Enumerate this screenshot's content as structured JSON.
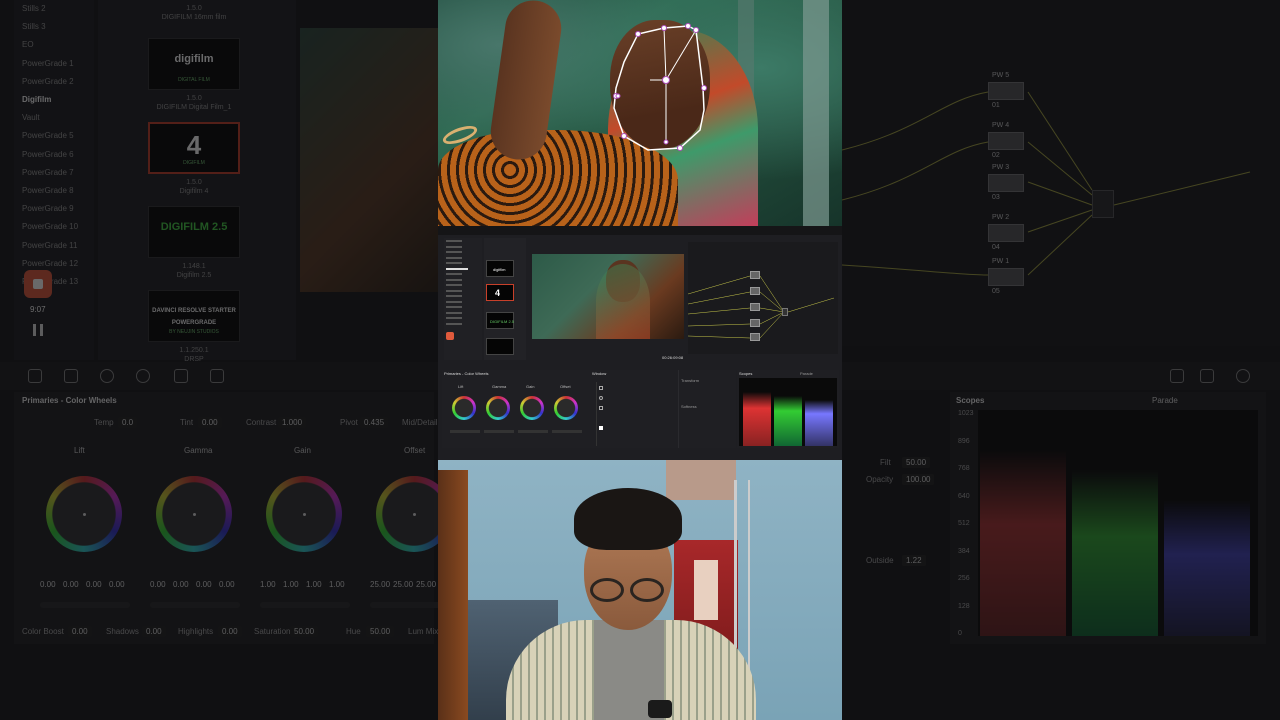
{
  "gallery": {
    "albums": [
      "Stills 2",
      "Stills 3",
      "EO",
      "PowerGrade 1",
      "PowerGrade 2",
      "Digifilm",
      "Vault",
      "PowerGrade 5",
      "PowerGrade 6",
      "PowerGrade 7",
      "PowerGrade 8",
      "PowerGrade 9",
      "PowerGrade 10",
      "PowerGrade 11",
      "PowerGrade 12",
      "PowerGrade 13"
    ],
    "selected": "Digifilm",
    "stills": [
      {
        "logo": "digifilm",
        "sub": "DIGITAL FILM",
        "id": "1.5.0",
        "name": "DIGIFILM Digital Film_1"
      },
      {
        "logo": "4",
        "sub": "DIGIFILM",
        "id": "1.5.0",
        "name": "Digifilm 4"
      },
      {
        "logo": "DIGIFILM 2.5",
        "sub": "",
        "id": "1.148.1",
        "name": "Digifilm 2.5"
      },
      {
        "logo": "DAVINCI RESOLVE STARTER POWERGRADE",
        "sub": "BY NEUJIN STUDIOS",
        "id": "1.1.250.1",
        "name": "DRSP"
      }
    ],
    "top_caption_id": "1.5.0",
    "top_caption_name": "DIGIFILM 16mm film"
  },
  "record": {
    "time": "9:07"
  },
  "primaries": {
    "title": "Primaries - Color Wheels",
    "temp_label": "Temp",
    "temp": "0.0",
    "tint_label": "Tint",
    "tint": "0.00",
    "contrast_label": "Contrast",
    "contrast": "1.000",
    "pivot_label": "Pivot",
    "pivot": "0.435",
    "middetail_label": "Mid/Detail",
    "wheels": [
      {
        "name": "Lift",
        "values": [
          "0.00",
          "0.00",
          "0.00",
          "0.00"
        ]
      },
      {
        "name": "Gamma",
        "values": [
          "0.00",
          "0.00",
          "0.00",
          "0.00"
        ]
      },
      {
        "name": "Gain",
        "values": [
          "1.00",
          "1.00",
          "1.00",
          "1.00"
        ]
      },
      {
        "name": "Offset",
        "values": [
          "25.00",
          "25.00",
          "25.00"
        ]
      }
    ],
    "color_boost_label": "Color Boost",
    "color_boost": "0.00",
    "shadows_label": "Shadows",
    "shadows": "0.00",
    "highlights_label": "Highlights",
    "highlights": "0.00",
    "saturation_label": "Saturation",
    "saturation": "50.00",
    "hue_label": "Hue",
    "hue": "50.00",
    "lummix_label": "Lum Mix"
  },
  "nodes": [
    "PW 5",
    "PW 4",
    "PW 3",
    "PW 2",
    "PW 1"
  ],
  "node_ids": [
    "01",
    "02",
    "03",
    "04",
    "05"
  ],
  "keyer": {
    "filt_label": "Filt",
    "filt": "50.00",
    "opacity_label": "Opacity",
    "opacity": "100.00",
    "outside_label": "Outside",
    "outside": "1.22"
  },
  "scopes": {
    "title": "Scopes",
    "mode": "Parade",
    "ticks": [
      "1023",
      "896",
      "768",
      "640",
      "512",
      "384",
      "256",
      "128",
      "0"
    ]
  },
  "ui_small": {
    "timecode": "00:26:09:08",
    "primaries": "Primaries - Color Wheels",
    "window": "Window",
    "scopes": "Scopes",
    "parade": "Parade",
    "lift": "Lift",
    "gamma": "Gamma",
    "gain": "Gain",
    "offset": "Offset",
    "transform": "Transform",
    "softness": "Softness"
  },
  "colors": {
    "accent": "#e05a3c",
    "selected_border": "#c8402a",
    "node_green": "#c8c84a"
  }
}
